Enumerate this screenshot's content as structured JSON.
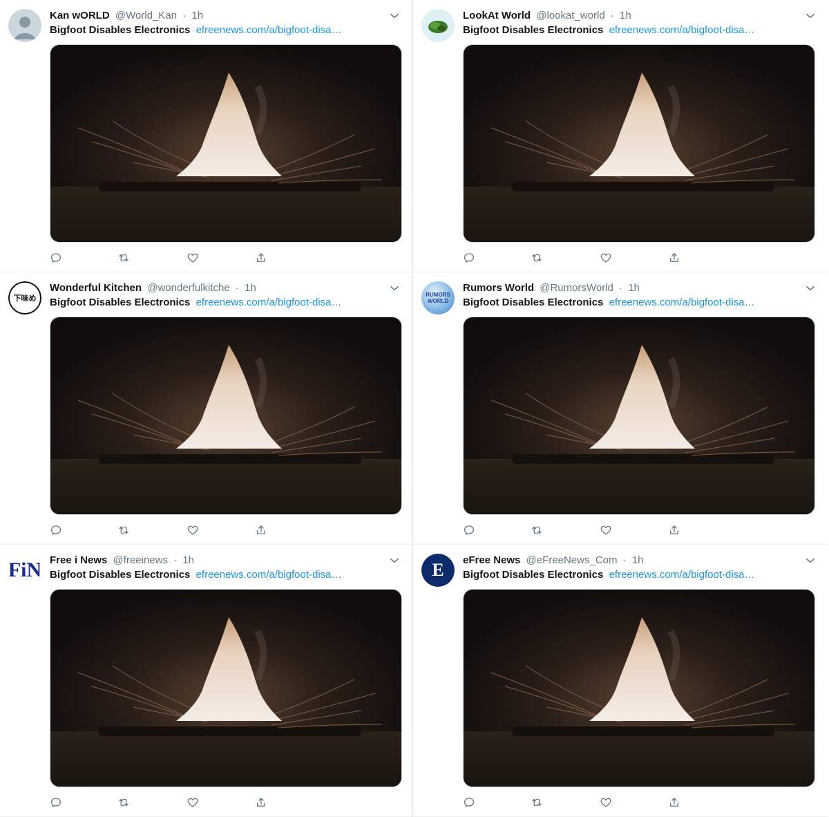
{
  "tweets": [
    {
      "name": "Kan wORLD",
      "handle": "@World_Kan",
      "time": "1h",
      "title": "Bigfoot Disables Electronics",
      "link": "efreenews.com/a/bigfoot-disa…",
      "avatar": "default-avatar"
    },
    {
      "name": "LookAt World",
      "handle": "@lookat_world",
      "time": "1h",
      "title": "Bigfoot Disables Electronics",
      "link": "efreenews.com/a/bigfoot-disa…",
      "avatar": "green-plant-avatar"
    },
    {
      "name": "Wonderful Kitchen",
      "handle": "@wonderfulkitche",
      "time": "1h",
      "title": "Bigfoot Disables Electronics",
      "link": "efreenews.com/a/bigfoot-disa…",
      "avatar": "kitchen-logo-avatar",
      "avatar_text": "下味め"
    },
    {
      "name": "Rumors World",
      "handle": "@RumorsWorld",
      "time": "1h",
      "title": "Bigfoot Disables Electronics",
      "link": "efreenews.com/a/bigfoot-disa…",
      "avatar": "globe-logo-avatar",
      "avatar_text": "RUMORS WORLD"
    },
    {
      "name": "Free i News",
      "handle": "@freeinews",
      "time": "1h",
      "title": "Bigfoot Disables Electronics",
      "link": "efreenews.com/a/bigfoot-disa…",
      "avatar": "fin-logo-avatar",
      "avatar_text": "FiN"
    },
    {
      "name": "eFree News",
      "handle": "@eFreeNews_Com",
      "time": "1h",
      "title": "Bigfoot Disables Electronics",
      "link": "efreenews.com/a/bigfoot-disa…",
      "avatar": "efree-logo-avatar",
      "avatar_text": "E"
    }
  ],
  "separator": "·",
  "icons": [
    "chevron-down-icon",
    "reply-icon",
    "retweet-icon",
    "like-icon",
    "share-icon"
  ],
  "colors": {
    "link": "#1b95e0",
    "muted": "#657786",
    "border": "#e6ecf0",
    "fin_blue": "#1a2a8f",
    "efree_navy": "#0d2b6b"
  }
}
